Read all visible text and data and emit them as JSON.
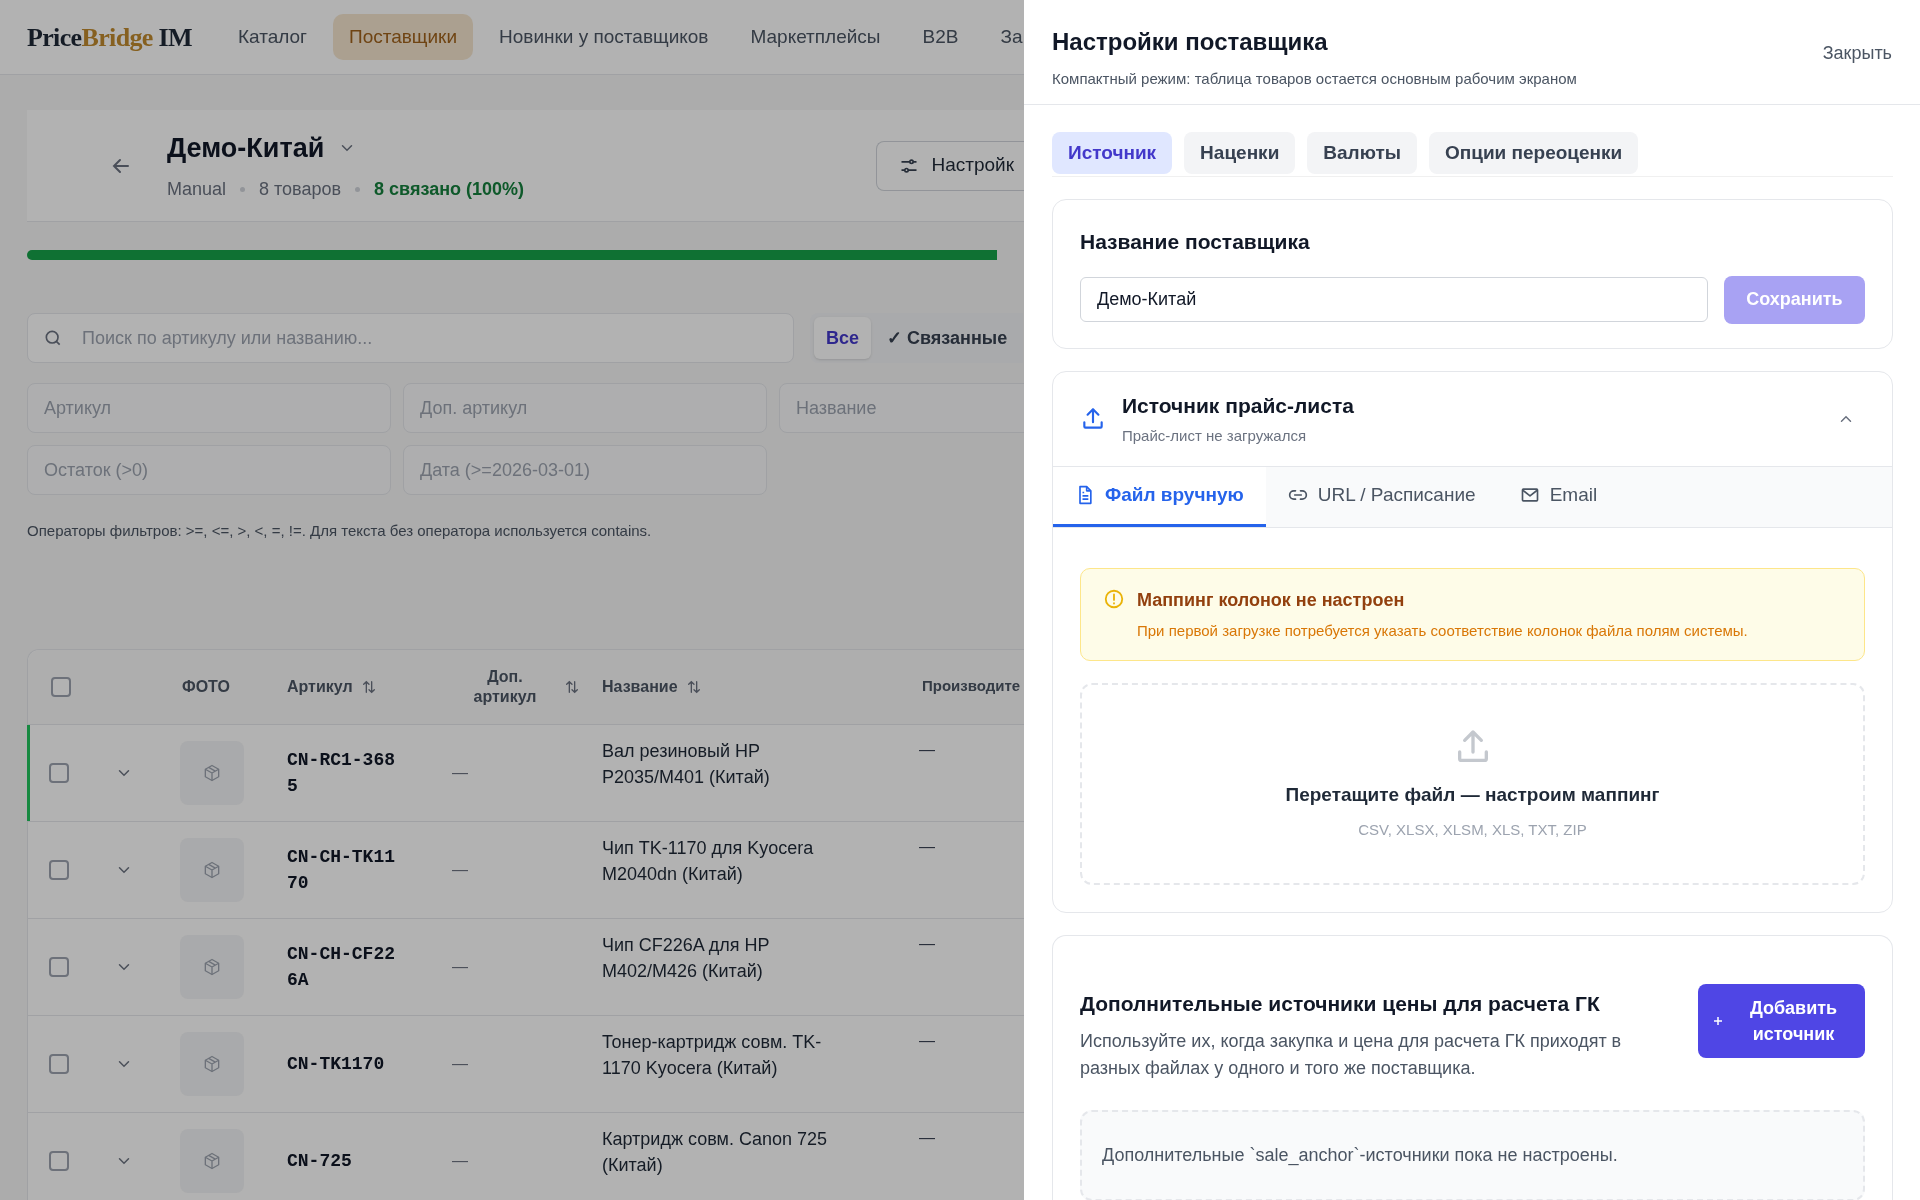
{
  "logo": [
    {
      "text": "Price",
      "accent": false
    },
    {
      "text": "Bridge",
      "accent": true
    },
    {
      "text": " IM",
      "accent": false
    }
  ],
  "nav": [
    {
      "label": "Каталог",
      "selected": false
    },
    {
      "label": "Поставщики",
      "selected": true
    },
    {
      "label": "Новинки у поставщиков",
      "selected": false
    },
    {
      "label": "Маркетплейсы",
      "selected": false
    },
    {
      "label": "B2B",
      "selected": false
    },
    {
      "label": "За",
      "selected": false
    }
  ],
  "supplier": {
    "title": "Демо-Китай",
    "meta": [
      {
        "text": "Manual",
        "kind": "plain"
      },
      {
        "text": "8 товаров",
        "kind": "plain"
      },
      {
        "text": "8 связано (100%)",
        "kind": "good"
      }
    ],
    "settings_button": "Настройк"
  },
  "progress": {
    "level": 1
  },
  "search": {
    "placeholder": "Поиск по артикулу или названию..."
  },
  "link_filters": [
    {
      "label": "Все",
      "selected": true
    },
    {
      "label": "✓ Связанные",
      "selected": false
    }
  ],
  "filters": [
    {
      "placeholder": "Артикул"
    },
    {
      "placeholder": "Доп. артикул"
    },
    {
      "placeholder": "Название"
    },
    {
      "placeholder": "Остаток (>0)"
    },
    {
      "placeholder": "Дата (>=2026-03-01)"
    }
  ],
  "filter_hint": "Операторы фильтров: >=, <=, >, <, =, !=. Для текста без оператора используется contains.",
  "table": {
    "select_all_checked": false,
    "columns": [
      {
        "label": "ФОТО",
        "sortable": false
      },
      {
        "label": "Артикул",
        "sortable": true
      },
      {
        "label": "Доп. артикул",
        "sortable": true
      },
      {
        "label": "Название",
        "sortable": true
      },
      {
        "label": "Производите",
        "sortable": false
      }
    ],
    "rows": [
      {
        "checked": false,
        "highlighted": true,
        "sku": "CN-RC1-3685",
        "sku2": "—",
        "name": "Вал резиновый HP P2035/M401 (Китай)",
        "maker": "—"
      },
      {
        "checked": false,
        "highlighted": false,
        "sku": "CN-CH-TK1170",
        "sku2": "—",
        "name": "Чип TK-1170 для Kyocera M2040dn (Китай)",
        "maker": "—"
      },
      {
        "checked": false,
        "highlighted": false,
        "sku": "CN-CH-CF226A",
        "sku2": "—",
        "name": "Чип CF226A для HP M402/M426 (Китай)",
        "maker": "—"
      },
      {
        "checked": false,
        "highlighted": false,
        "sku": "CN-TK1170",
        "sku2": "—",
        "name": "Тонер-картридж совм. TK-1170 Kyocera (Китай)",
        "maker": "—"
      },
      {
        "checked": false,
        "highlighted": false,
        "sku": "CN-725",
        "sku2": "—",
        "name": "Картридж совм. Canon 725 (Китай)",
        "maker": "—"
      }
    ]
  },
  "panel": {
    "title": "Настройки поставщика",
    "subtitle": "Компактный режим: таблица товаров остается основным рабочим экраном",
    "close": "Закрыть",
    "tabs": [
      {
        "label": "Источник",
        "selected": true
      },
      {
        "label": "Наценки",
        "selected": false
      },
      {
        "label": "Валюты",
        "selected": false
      },
      {
        "label": "Опции переоценки",
        "selected": false
      }
    ],
    "name_card": {
      "title": "Название поставщика",
      "value": "Демо-Китай",
      "save": "Сохранить",
      "save_disabled": true
    },
    "source_card": {
      "title": "Источник прайс-листа",
      "subtitle": "Прайс-лист не загружался",
      "expanded": true,
      "tabs": [
        {
          "label": "Файл вручную",
          "kind": "file",
          "selected": true
        },
        {
          "label": "URL / Расписание",
          "kind": "link",
          "selected": false
        },
        {
          "label": "Email",
          "kind": "mail",
          "selected": false
        }
      ],
      "alert": {
        "title": "Маппинг колонок не настроен",
        "text": "При первой загрузке потребуется указать соответствие колонок файла полям системы."
      },
      "dropzone": {
        "text": "Перетащите файл — настроим маппинг",
        "formats": "CSV, XLSX, XLSM, XLS, TXT, ZIP"
      }
    },
    "extra_card": {
      "title": "Дополнительные источники цены для расчета ГК",
      "text": "Используйте их, когда закупка и цена для расчета ГК приходят в разных файлах у одного и того же поставщика.",
      "button": "Добавить источник",
      "empty": "Дополнительные `sale_anchor`-источники пока не настроены."
    }
  }
}
